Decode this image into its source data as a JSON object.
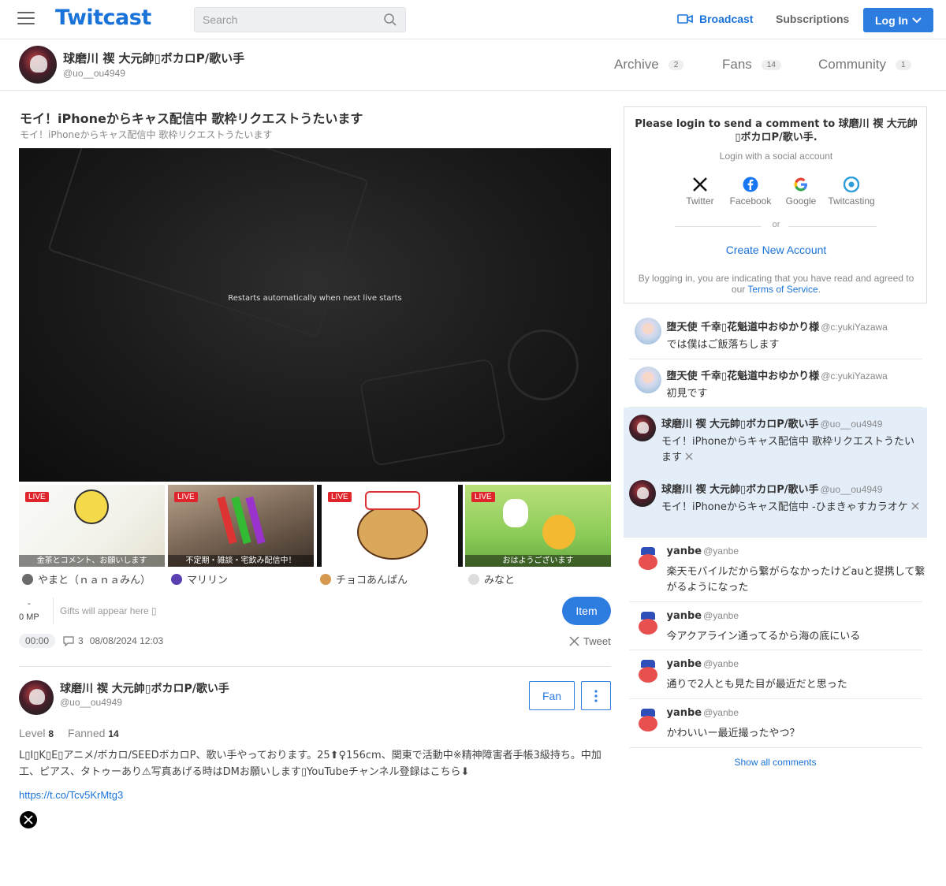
{
  "header": {
    "logo": "Twitcast",
    "search_placeholder": "Search",
    "broadcast_label": "Broadcast",
    "subscriptions_label": "Subscriptions",
    "login_label": "Log In"
  },
  "profile": {
    "name": "球磨川 禊 大元帥▯ボカロP/歌い手",
    "handle": "@uo__ou4949",
    "tabs": [
      {
        "label": "Archive",
        "count": "2"
      },
      {
        "label": "Fans",
        "count": "14"
      },
      {
        "label": "Community",
        "count": "1"
      }
    ]
  },
  "broadcast": {
    "title": "モイ！iPhoneからキャス配信中 歌枠リクエストうたいます",
    "subtitle": "モイ！iPhoneからキャス配信中 歌枠リクエストうたいます",
    "player_message": "Restarts automatically when next live starts",
    "mp_dash": "-",
    "mp_label": "0 MP",
    "gifts_text": "Gifts will appear here ▯",
    "item_label": "Item",
    "elapsed": "00:00",
    "comment_count": "3",
    "datetime": "08/08/2024 12:03",
    "tweet_label": "Tweet"
  },
  "live_cards": [
    {
      "badge": "LIVE",
      "caption": "金茶とコメント、お願いします",
      "user": "やまと（ｎａｎａみん）",
      "accent": "#6b6b6b"
    },
    {
      "badge": "LIVE",
      "caption": "不定期・雑談・宅飲み配信中！",
      "user": "マリリン",
      "accent": "#5a3fb0"
    },
    {
      "badge": "LIVE",
      "caption": "",
      "user": "チョコあんぱん",
      "accent": "#d59a4f"
    },
    {
      "badge": "LIVE",
      "caption": "おはようございます",
      "user": "みなと",
      "accent": "#dddddd"
    }
  ],
  "bio": {
    "name": "球磨川 禊 大元帥▯ボカロP/歌い手",
    "handle": "@uo__ou4949",
    "fan_label": "Fan",
    "level_label": "Level",
    "level_value": "8",
    "fanned_label": "Fanned",
    "fanned_value": "14",
    "text": "L▯I▯K▯E▯アニメ/ボカロ/SEEDボカロP、歌い手やっております。25⬆♀156cm、関東で活動中※精神障害者手帳3級持ち。中加工、ピアス、タトゥーあり⚠写真あげる時はDMお願いします▯YouTubeチャンネル登録はこちら⬇",
    "link": "https://t.co/Tcv5KrMtg3"
  },
  "login_box": {
    "title": "Please login to send a comment to 球磨川 禊 大元帥▯ボカロP/歌い手.",
    "subtitle": "Login with a social account",
    "providers": [
      "Twitter",
      "Facebook",
      "Google",
      "Twitcasting"
    ],
    "or": "or",
    "create_account": "Create New Account",
    "terms_prefix": "By logging in, you are indicating that you have read and agreed to our",
    "terms_link": "Terms of Service",
    "terms_suffix": "."
  },
  "comments": [
    {
      "name": "堕天使 千幸▯花魁道中おゆかり様",
      "handle": "@c:yukiYazawa",
      "text": "では僕はご飯落ちします",
      "avatar": "angel",
      "highlight": false
    },
    {
      "name": "堕天使 千幸▯花魁道中おゆかり様",
      "handle": "@c:yukiYazawa",
      "text": "初見です",
      "avatar": "angel",
      "highlight": false
    },
    {
      "name": "球磨川 禊 大元帥▯ボカロP/歌い手",
      "handle": "@uo__ou4949",
      "text": "モイ！iPhoneからキャス配信中 歌枠リクエストうたいます",
      "avatar": "owner",
      "highlight": true
    },
    {
      "name": "球磨川 禊 大元帥▯ボカロP/歌い手",
      "handle": "@uo__ou4949",
      "text": "モイ！iPhoneからキャス配信中 -ひまきゃすカラオケ",
      "avatar": "owner",
      "highlight": true
    },
    {
      "name": "yanbe",
      "handle": "@yanbe",
      "text": "楽天モバイルだから繋がらなかったけどauと提携して繋がるようになった",
      "avatar": "yanbe",
      "highlight": false
    },
    {
      "name": "yanbe",
      "handle": "@yanbe",
      "text": "今アクアライン通ってるから海の底にいる",
      "avatar": "yanbe",
      "highlight": false
    },
    {
      "name": "yanbe",
      "handle": "@yanbe",
      "text": "通りで2人とも見た目が最近だと思った",
      "avatar": "yanbe",
      "highlight": false
    },
    {
      "name": "yanbe",
      "handle": "@yanbe",
      "text": "かわいいー最近撮ったやつ？",
      "avatar": "yanbe",
      "highlight": false
    }
  ],
  "show_all_comments": "Show all comments",
  "colors": {
    "accent": "#2d7ce0",
    "live": "#e0242c",
    "highlight": "#e4eef9"
  }
}
